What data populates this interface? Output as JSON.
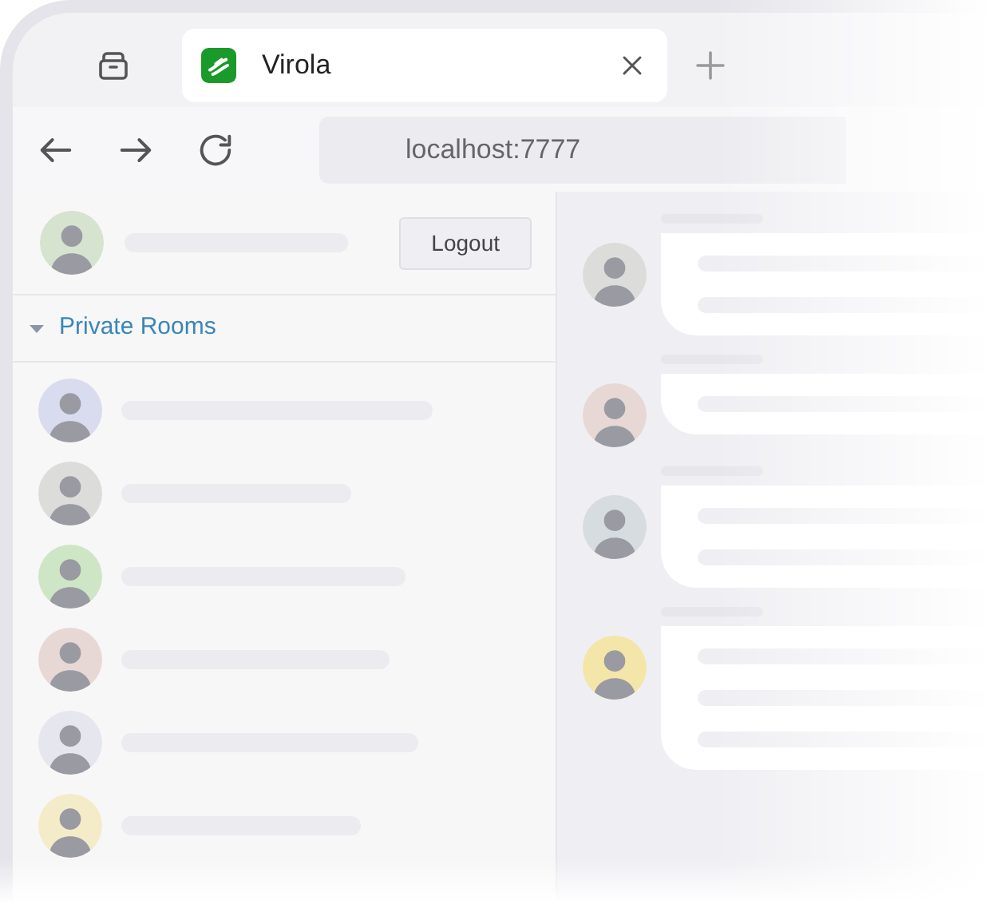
{
  "browser": {
    "tab": {
      "title": "Virola",
      "selected": true
    },
    "url": "localhost:7777"
  },
  "user": {
    "logout": "Logout"
  },
  "section": {
    "title": "Private Rooms",
    "expanded": true
  },
  "rooms": [
    {
      "color": "#d9dcef"
    },
    {
      "color": "#dcdcda"
    },
    {
      "color": "#cfe6c6"
    },
    {
      "color": "#e8d8d5"
    },
    {
      "color": "#e6e6ee"
    },
    {
      "color": "#f4ecc8"
    }
  ],
  "messages": [
    {
      "color": "#dcdcda",
      "kind": "double"
    },
    {
      "color": "#e8d8d5",
      "kind": "single"
    },
    {
      "color": "#d6dcdf",
      "kind": "double"
    },
    {
      "color": "#f4e6a8",
      "kind": "triple"
    }
  ]
}
